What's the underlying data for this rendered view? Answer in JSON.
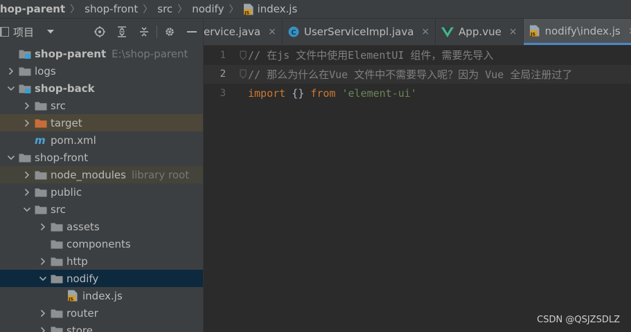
{
  "breadcrumb": {
    "items": [
      "shop-parent",
      "shop-front",
      "src",
      "nodify"
    ],
    "file": "index.js"
  },
  "sidebar": {
    "title": "项目",
    "toolbar_icons": [
      "crosshair-icon",
      "expand-all-icon",
      "collapse-all-icon",
      "gear-icon",
      "minimize-icon"
    ],
    "tree": [
      {
        "label": "shop-parent",
        "hint": "E:\\shop-parent",
        "depth": 0,
        "arrow": "none",
        "icon": "module-folder",
        "bold": true
      },
      {
        "label": "logs",
        "depth": 0,
        "arrow": "collapsed",
        "icon": "folder"
      },
      {
        "label": "shop-back",
        "depth": 0,
        "arrow": "expanded",
        "icon": "module-folder",
        "bold": true
      },
      {
        "label": "src",
        "depth": 1,
        "arrow": "collapsed",
        "icon": "folder"
      },
      {
        "label": "target",
        "depth": 1,
        "arrow": "collapsed",
        "icon": "folder-excluded",
        "state": "excluded"
      },
      {
        "label": "pom.xml",
        "depth": 1,
        "arrow": "none",
        "icon": "maven"
      },
      {
        "label": "shop-front",
        "depth": 0,
        "arrow": "expanded",
        "icon": "folder"
      },
      {
        "label": "node_modules",
        "hint": "library root",
        "depth": 1,
        "arrow": "collapsed",
        "icon": "folder",
        "state": "library"
      },
      {
        "label": "public",
        "depth": 1,
        "arrow": "collapsed",
        "icon": "folder"
      },
      {
        "label": "src",
        "depth": 1,
        "arrow": "expanded",
        "icon": "folder"
      },
      {
        "label": "assets",
        "depth": 2,
        "arrow": "collapsed",
        "icon": "folder"
      },
      {
        "label": "components",
        "depth": 2,
        "arrow": "none",
        "icon": "folder"
      },
      {
        "label": "http",
        "depth": 2,
        "arrow": "collapsed",
        "icon": "folder"
      },
      {
        "label": "nodify",
        "depth": 2,
        "arrow": "expanded",
        "icon": "folder",
        "state": "selected"
      },
      {
        "label": "index.js",
        "depth": 3,
        "arrow": "none",
        "icon": "js-file"
      },
      {
        "label": "router",
        "depth": 2,
        "arrow": "collapsed",
        "icon": "folder"
      },
      {
        "label": "store",
        "depth": 2,
        "arrow": "collapsed",
        "icon": "folder"
      }
    ]
  },
  "tabs": [
    {
      "label": "ervice.java",
      "icon": "java-class",
      "active": false
    },
    {
      "label": "UserServiceImpl.java",
      "icon": "java-class",
      "active": false
    },
    {
      "label": "App.vue",
      "icon": "vue",
      "active": false
    },
    {
      "label": "nodify\\index.js",
      "icon": "js-file",
      "active": true
    }
  ],
  "close_glyph": "×",
  "code": [
    {
      "num": "1",
      "parts": [
        {
          "cls": "comment",
          "text": "// 在js 文件中使用ElementUI 组件，需要先导入"
        }
      ]
    },
    {
      "num": "2",
      "current": true,
      "parts": [
        {
          "cls": "comment",
          "text": "// 那么为什么在Vue 文件中不需要导入呢？因为 Vue 全局注册过了"
        }
      ]
    },
    {
      "num": "3",
      "parts": [
        {
          "cls": "kw",
          "text": "import"
        },
        {
          "cls": "plain",
          "text": " {} "
        },
        {
          "cls": "kw",
          "text": "from"
        },
        {
          "cls": "plain",
          "text": " "
        },
        {
          "cls": "str",
          "text": "'element-ui'"
        }
      ]
    }
  ],
  "watermark": "CSDN @QSJZSDLZ",
  "colors": {
    "background": "#2b2b2b",
    "panel": "#3c3f41",
    "selection": "#0d293e",
    "active_tab_underline": "#4a88c7",
    "comment": "#808080",
    "keyword": "#cc7832",
    "string": "#6a8759",
    "folder": "#8d9092",
    "excluded_folder": "#c76d3a"
  }
}
